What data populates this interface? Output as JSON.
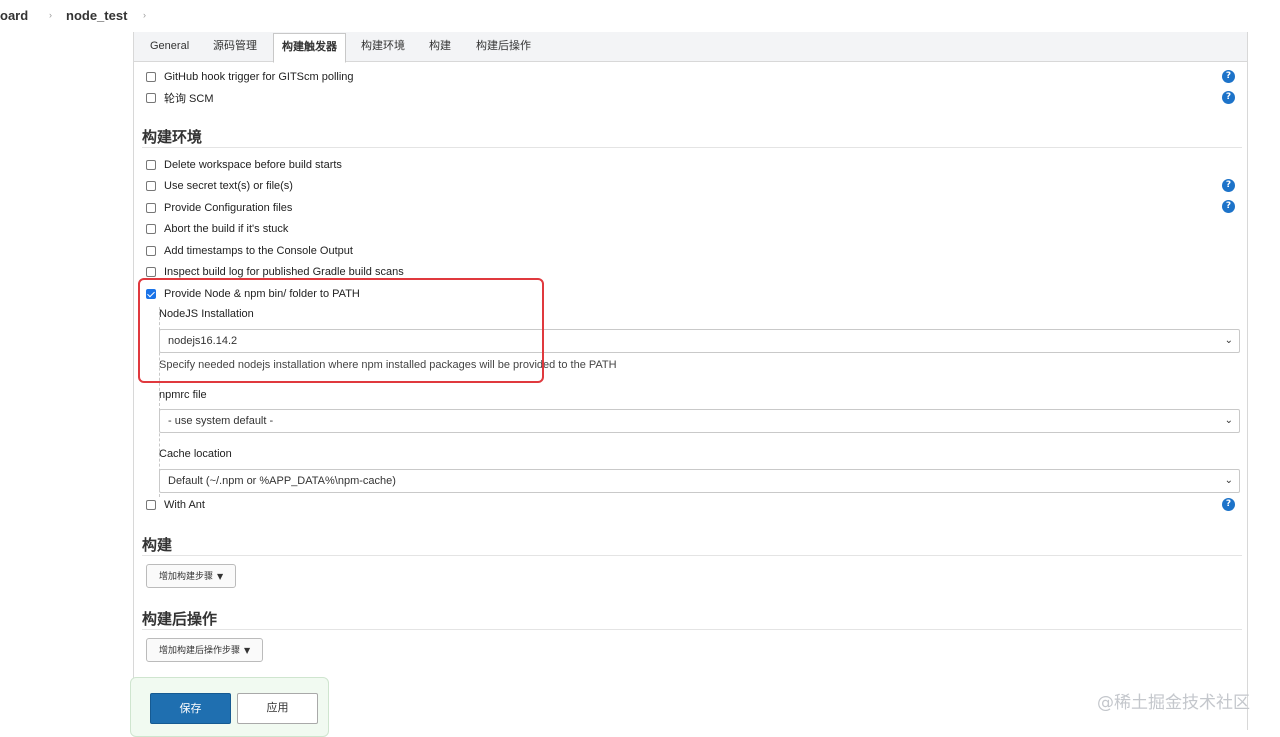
{
  "breadcrumb": {
    "items": [
      "oard",
      "node_test"
    ],
    "separator": "›"
  },
  "tabs": [
    {
      "label": "General",
      "active": false
    },
    {
      "label": "源码管理",
      "active": false
    },
    {
      "label": "构建触发器",
      "active": true
    },
    {
      "label": "构建环境",
      "active": false
    },
    {
      "label": "构建",
      "active": false
    },
    {
      "label": "构建后操作",
      "active": false
    }
  ],
  "triggers": [
    {
      "label": "GitHub hook trigger for GITScm polling",
      "checked": false,
      "help": true
    },
    {
      "label": "轮询 SCM",
      "checked": false,
      "help": true
    }
  ],
  "build_env": {
    "title": "构建环境",
    "options": [
      {
        "label": "Delete workspace before build starts",
        "checked": false,
        "help": false
      },
      {
        "label": "Use secret text(s) or file(s)",
        "checked": false,
        "help": true
      },
      {
        "label": "Provide Configuration files",
        "checked": false,
        "help": true
      },
      {
        "label": "Abort the build if it's stuck",
        "checked": false,
        "help": false
      },
      {
        "label": "Add timestamps to the Console Output",
        "checked": false,
        "help": false
      },
      {
        "label": "Inspect build log for published Gradle build scans",
        "checked": false,
        "help": false
      },
      {
        "label": "Provide Node & npm bin/ folder to PATH",
        "checked": true,
        "help": false
      }
    ],
    "nodejs": {
      "label": "NodeJS Installation",
      "value": "nodejs16.14.2",
      "description": "Specify needed nodejs installation where npm installed packages will be provided to the PATH"
    },
    "npmrc": {
      "label": "npmrc file",
      "value": "- use system default -"
    },
    "cache": {
      "label": "Cache location",
      "value": "Default (~/.npm or %APP_DATA%\\npm-cache)"
    },
    "with_ant": {
      "label": "With Ant",
      "checked": false,
      "help": true
    }
  },
  "build": {
    "title": "构建",
    "add_step": "增加构建步骤"
  },
  "post_build": {
    "title": "构建后操作",
    "add_step": "增加构建后操作步骤"
  },
  "actions": {
    "save": "保存",
    "apply": "应用"
  },
  "icons": {
    "help": "help-icon",
    "chevron": "chevron-down-icon",
    "caret": "caret-down-icon"
  },
  "colors": {
    "accent": "#1f6fb0",
    "help": "#1d73c9",
    "highlight": "#e0393e",
    "checkbox_checked": "#1a73e8"
  },
  "watermark": "@稀土掘金技术社区"
}
